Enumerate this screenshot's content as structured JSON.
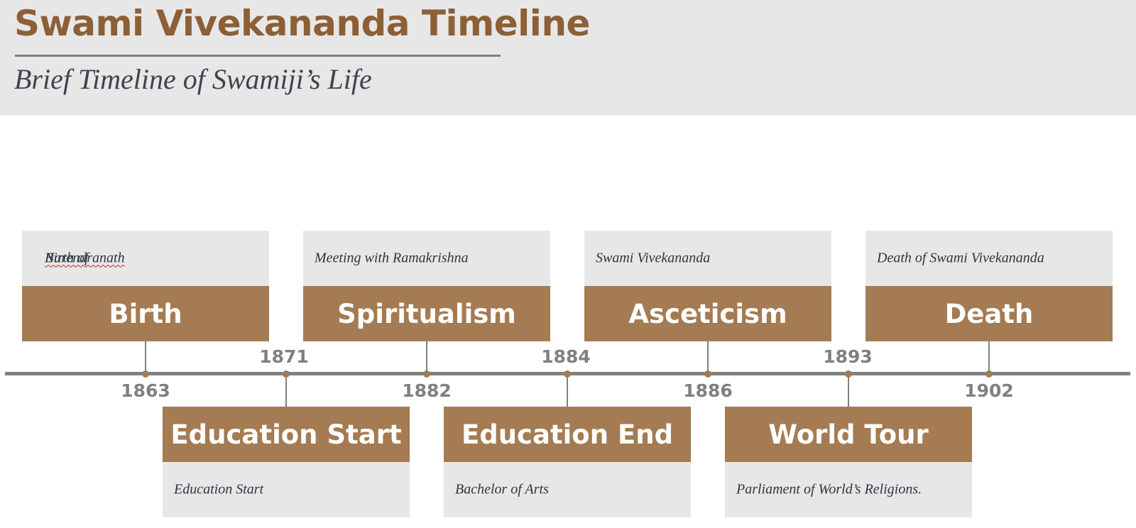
{
  "header": {
    "title": "Swami Vivekananda Timeline",
    "subtitle": "Brief Timeline of Swamiji’s Life"
  },
  "colors": {
    "accent": "#a47b52",
    "title": "#8c5f36",
    "panel": "#e7e7e7",
    "axis": "#808080"
  },
  "events": [
    {
      "year": "1863",
      "label": "Birth",
      "description_prefix": "Birth of ",
      "description_suffix": "Narendranath",
      "position": "above"
    },
    {
      "year": "1871",
      "label": "Education Start",
      "description": "Education Start",
      "position": "below"
    },
    {
      "year": "1882",
      "label": "Spiritualism",
      "description": "Meeting with Ramakrishna",
      "position": "above"
    },
    {
      "year": "1884",
      "label": "Education End",
      "description": "Bachelor of Arts",
      "position": "below"
    },
    {
      "year": "1886",
      "label": "Asceticism",
      "description": "Swami Vivekananda",
      "position": "above"
    },
    {
      "year": "1893",
      "label": "World Tour",
      "description": "Parliament of World’s Religions.",
      "position": "below"
    },
    {
      "year": "1902",
      "label": "Death",
      "description": "Death of Swami Vivekananda",
      "position": "above"
    }
  ]
}
